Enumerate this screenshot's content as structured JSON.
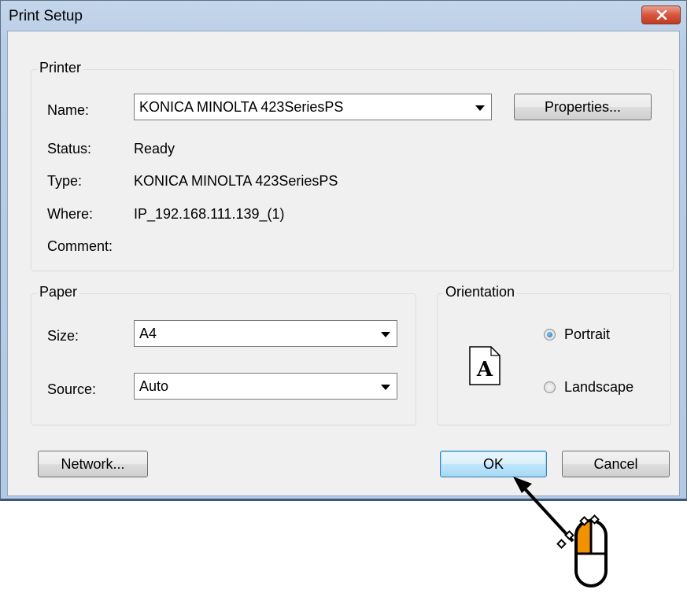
{
  "window": {
    "title": "Print Setup"
  },
  "printer": {
    "legend": "Printer",
    "name_label": "Name:",
    "name_value": "KONICA MINOLTA 423SeriesPS",
    "properties_label": "Properties...",
    "status_label": "Status:",
    "status_value": "Ready",
    "type_label": "Type:",
    "type_value": "KONICA MINOLTA 423SeriesPS",
    "where_label": "Where:",
    "where_value": "IP_192.168.111.139_(1)",
    "comment_label": "Comment:",
    "comment_value": ""
  },
  "paper": {
    "legend": "Paper",
    "size_label": "Size:",
    "size_value": "A4",
    "source_label": "Source:",
    "source_value": "Auto"
  },
  "orientation": {
    "legend": "Orientation",
    "portrait_label": "Portrait",
    "landscape_label": "Landscape",
    "selected": "Portrait",
    "icon_letter": "A"
  },
  "buttons": {
    "network_label": "Network...",
    "ok_label": "OK",
    "cancel_label": "Cancel"
  },
  "annotation": {
    "icon": "mouse-click-icon",
    "accent": "#f39200",
    "target": "OK"
  },
  "colors": {
    "close_button": "#d7553d",
    "default_button": "#3c7fb1",
    "title_bar": "#b8cde6"
  }
}
